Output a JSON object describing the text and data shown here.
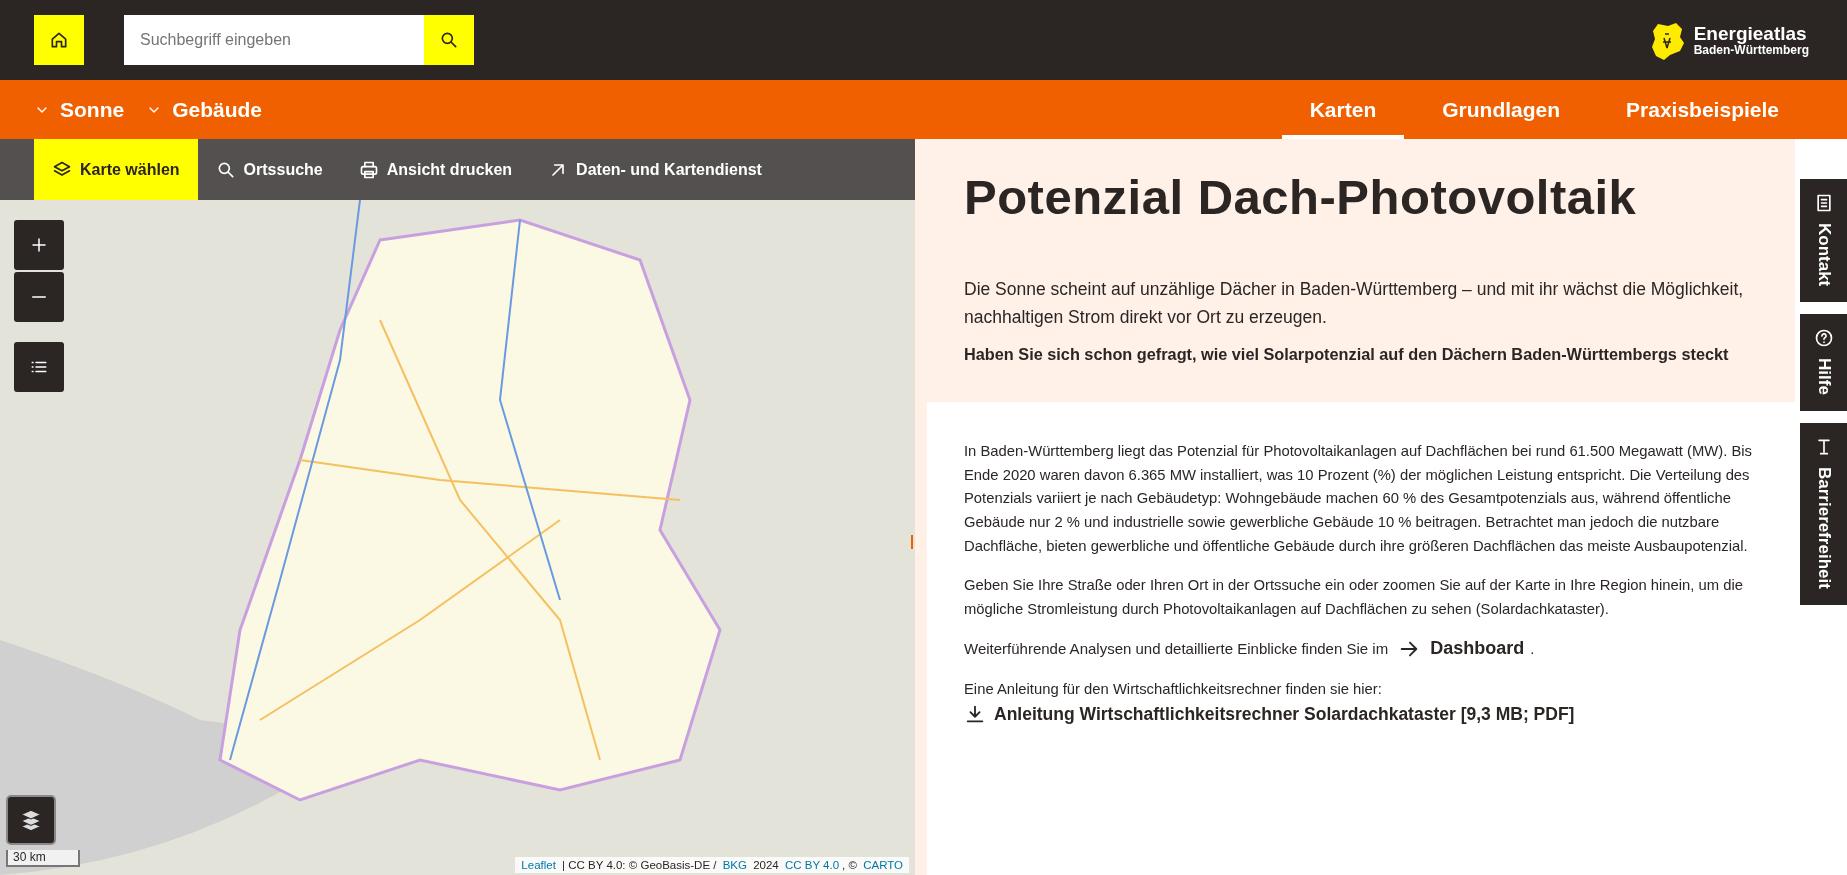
{
  "header": {
    "search": {
      "placeholder": "Suchbegriff eingeben"
    },
    "logo": {
      "title": "Energieatlas",
      "subtitle": "Baden-Württemberg"
    }
  },
  "nav": {
    "menus": [
      {
        "label": "Sonne",
        "expanded": false
      },
      {
        "label": "Gebäude",
        "expanded": false
      }
    ],
    "tabs": [
      {
        "label": "Karten",
        "selected": true
      },
      {
        "label": "Grundlagen",
        "selected": false
      },
      {
        "label": "Praxisbeispiele",
        "selected": false
      }
    ]
  },
  "map_toolbar": [
    {
      "label": "Karte wählen",
      "kind": "layers",
      "selected": true
    },
    {
      "label": "Ortssuche",
      "kind": "search",
      "selected": false
    },
    {
      "label": "Ansicht drucken",
      "kind": "print",
      "selected": false
    },
    {
      "label": "Daten- und Kartendienst",
      "kind": "external",
      "selected": false
    }
  ],
  "map": {
    "scale": "30 km",
    "attribution": [
      {
        "kind": "link",
        "text": "Leaflet"
      },
      {
        "kind": "text",
        "text": " | CC BY 4.0: © GeoBasis-DE / "
      },
      {
        "kind": "link",
        "text": "BKG"
      },
      {
        "kind": "text",
        "text": " 2024 "
      },
      {
        "kind": "link",
        "text": "CC BY 4.0"
      },
      {
        "kind": "text",
        "text": ", © "
      },
      {
        "kind": "link",
        "text": "CARTO"
      }
    ]
  },
  "content": {
    "title": "Potenzial Dach-Photovoltaik",
    "intro": "Die Sonne scheint auf unzählige Dächer in Baden-Württemberg – und mit ihr wächst die Möglichkeit, nachhaltigen Strom direkt vor Ort zu erzeugen.",
    "question": "Haben Sie sich schon gefragt, wie viel Solarpotenzial auf den Dächern Baden-Württembergs steckt",
    "paragraphs": [
      "In Baden-Württemberg liegt das Potenzial für Photovoltaikanlagen auf Dachflächen bei rund 61.500 Megawatt (MW). Bis Ende 2020 waren davon 6.365 MW installiert, was 10 Prozent (%) der möglichen Leistung entspricht. Die Verteilung des Potenzials variiert je nach Gebäudetyp: Wohngebäude machen 60 % des Gesamtpotenzials aus, während öffentliche Gebäude nur 2 % und industrielle sowie gewerbliche Gebäude 10 % beitragen. Betrachtet man jedoch die nutzbare Dachfläche, bieten gewerbliche und öffentliche Gebäude durch ihre größeren Dachflächen das meiste Ausbaupotenzial.",
      "Geben Sie Ihre Straße oder Ihren Ort in der Ortssuche ein oder zoomen Sie auf der Karte in Ihre Region hinein, um die mögliche Stromleistung durch Photovoltaikanlagen auf Dachflächen zu sehen (Solardachkataster)."
    ],
    "dashboard": {
      "text": "Weiterführende Analysen und detaillierte Einblicke finden Sie im",
      "link": "Dashboard",
      "after": "."
    },
    "guide": {
      "text": "Eine Anleitung für den Wirtschaftlichkeitsrechner finden sie hier:",
      "link": "Anleitung Wirtschaftlichkeitsrechner Solardachkataster [9,3 MB; PDF]"
    }
  },
  "side_tabs": [
    {
      "label": "Kontakt",
      "kind": "contact"
    },
    {
      "label": "Hilfe",
      "kind": "help"
    },
    {
      "label": "Barrierefreiheit",
      "kind": "accessibility"
    }
  ]
}
